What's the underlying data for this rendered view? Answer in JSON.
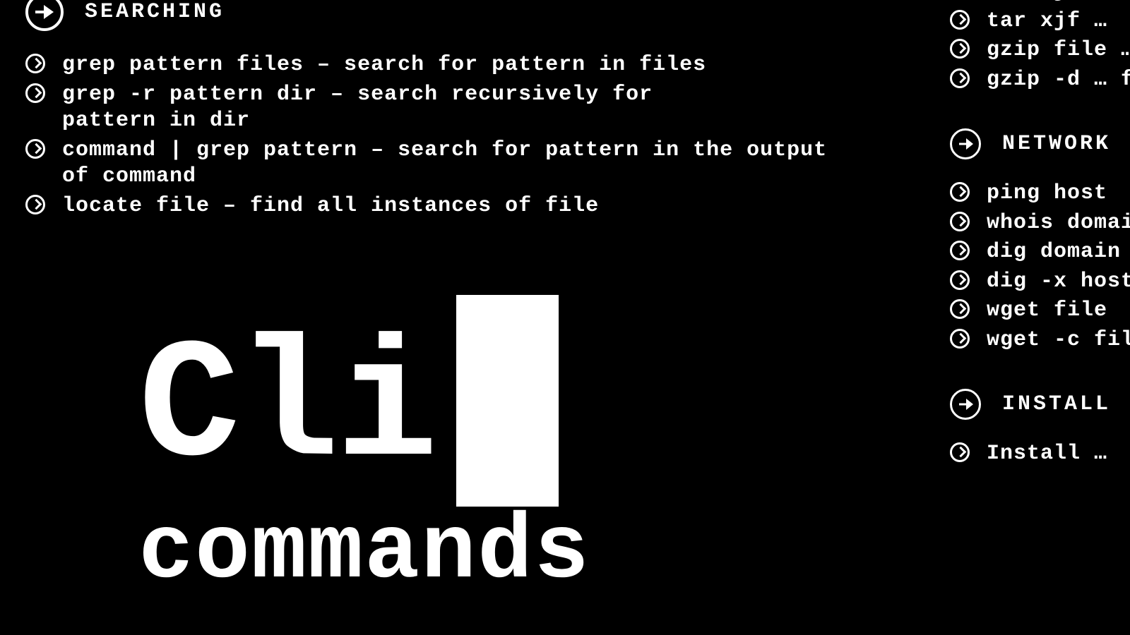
{
  "sections": {
    "searching": {
      "title": "SEARCHING",
      "items": [
        "grep pattern files – search for pattern in files",
        "grep -r pattern dir – search recursively for pattern in dir",
        "command | grep pattern – search for pattern in the output of command",
        "locate file – find all instances of file"
      ]
    },
    "compress_partial": {
      "items": [
        "tar cjf … compress…",
        "tar xjf …",
        "gzip file … file.gz",
        "gzip -d … file"
      ]
    },
    "network": {
      "title": "NETWORK",
      "items": [
        "ping host",
        "whois domain",
        "dig domain",
        "dig -x host",
        "wget file",
        "wget -c file"
      ]
    },
    "install": {
      "title": "INSTALL",
      "items": [
        "Install …"
      ]
    }
  },
  "logo": {
    "line1": "Cli",
    "line2": "commands"
  }
}
